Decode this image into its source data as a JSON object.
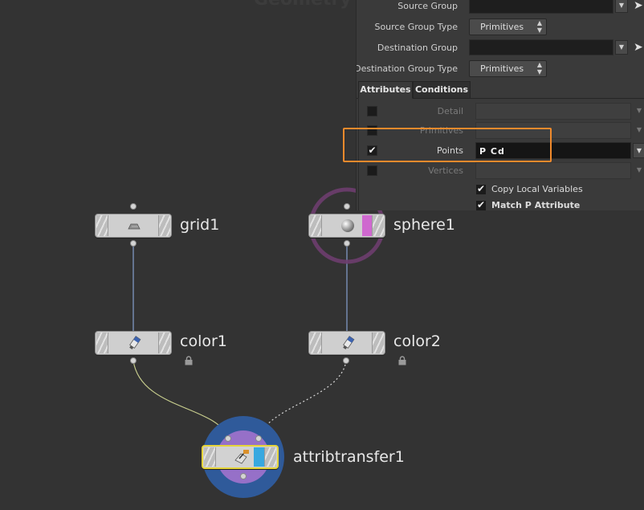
{
  "network": {
    "title": "Geometry",
    "nodes": {
      "grid1": {
        "label": "grid1"
      },
      "sphere1": {
        "label": "sphere1"
      },
      "color1": {
        "label": "color1"
      },
      "color2": {
        "label": "color2"
      },
      "attribtransfer1": {
        "label": "attribtransfer1"
      }
    }
  },
  "params": {
    "source_group": {
      "label": "Source Group",
      "value": ""
    },
    "source_group_type": {
      "label": "Source Group Type",
      "value": "Primitives"
    },
    "destination_group": {
      "label": "Destination Group",
      "value": ""
    },
    "destination_group_type": {
      "label": "Destination Group Type",
      "value": "Primitives"
    },
    "tabs": [
      {
        "label": "Attributes",
        "active": true
      },
      {
        "label": "Conditions",
        "active": false
      }
    ],
    "attributes": [
      {
        "label": "Detail",
        "checked": false,
        "value": ""
      },
      {
        "label": "Primitives",
        "checked": false,
        "value": ""
      },
      {
        "label": "Points",
        "checked": true,
        "value": "P  Cd"
      },
      {
        "label": "Vertices",
        "checked": false,
        "value": ""
      }
    ],
    "options": [
      {
        "label": "Copy Local Variables",
        "checked": true
      },
      {
        "label": "Match P Attribute",
        "checked": true
      }
    ]
  },
  "colors": {
    "highlight": "#f08a2c",
    "wire": "#7f98c4",
    "wire_selected": "#c9cf8e",
    "sphere_flag": "#cf68cf",
    "display_flag": "#37a8e0",
    "template_ring": "#6d3d6e"
  },
  "icons": {
    "grid": "grid-plane-icon",
    "sphere": "sphere-icon",
    "color": "paint-tube-icon",
    "attribtransfer": "attribute-transfer-icon",
    "lock": "lock-icon",
    "pick": "arrow-pointer-icon"
  }
}
